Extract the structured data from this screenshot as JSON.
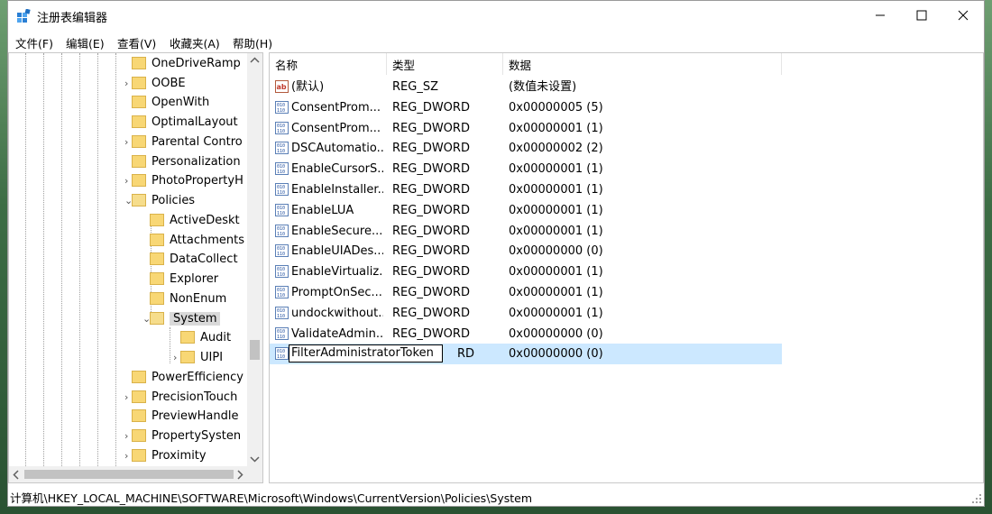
{
  "window": {
    "title": "注册表编辑器"
  },
  "menu": [
    "文件(F)",
    "编辑(E)",
    "查看(V)",
    "收藏夹(A)",
    "帮助(H)"
  ],
  "tree": [
    {
      "label": "OneDriveRamp",
      "expander": ""
    },
    {
      "label": "OOBE",
      "expander": "›"
    },
    {
      "label": "OpenWith",
      "expander": ""
    },
    {
      "label": "OptimalLayout",
      "expander": ""
    },
    {
      "label": "Parental Contro",
      "expander": "›"
    },
    {
      "label": "Personalization",
      "expander": ""
    },
    {
      "label": "PhotoPropertyH",
      "expander": "›"
    },
    {
      "label": "Policies",
      "expander": "⌄"
    },
    {
      "label": "ActiveDeskt",
      "expander": ""
    },
    {
      "label": "Attachments",
      "expander": ""
    },
    {
      "label": "DataCollect",
      "expander": ""
    },
    {
      "label": "Explorer",
      "expander": ""
    },
    {
      "label": "NonEnum",
      "expander": ""
    },
    {
      "label": "System",
      "expander": "⌄"
    },
    {
      "label": "Audit",
      "expander": ""
    },
    {
      "label": "UIPI",
      "expander": "›"
    },
    {
      "label": "PowerEfficiency",
      "expander": ""
    },
    {
      "label": "PrecisionTouch",
      "expander": "›"
    },
    {
      "label": "PreviewHandle",
      "expander": ""
    },
    {
      "label": "PropertySysten",
      "expander": "›"
    },
    {
      "label": "Proximity",
      "expander": "›"
    }
  ],
  "columns": {
    "name": "名称",
    "type": "类型",
    "data": "数据"
  },
  "values": [
    {
      "name": "(默认)",
      "type": "REG_SZ",
      "data": "(数值未设置)",
      "icon": "string-value-icon"
    },
    {
      "name": "ConsentProm...",
      "type": "REG_DWORD",
      "data": "0x00000005 (5)",
      "icon": "dword-value-icon"
    },
    {
      "name": "ConsentProm...",
      "type": "REG_DWORD",
      "data": "0x00000001 (1)",
      "icon": "dword-value-icon"
    },
    {
      "name": "DSCAutomatio...",
      "type": "REG_DWORD",
      "data": "0x00000002 (2)",
      "icon": "dword-value-icon"
    },
    {
      "name": "EnableCursorS...",
      "type": "REG_DWORD",
      "data": "0x00000001 (1)",
      "icon": "dword-value-icon"
    },
    {
      "name": "EnableInstaller...",
      "type": "REG_DWORD",
      "data": "0x00000001 (1)",
      "icon": "dword-value-icon"
    },
    {
      "name": "EnableLUA",
      "type": "REG_DWORD",
      "data": "0x00000001 (1)",
      "icon": "dword-value-icon"
    },
    {
      "name": "EnableSecure...",
      "type": "REG_DWORD",
      "data": "0x00000001 (1)",
      "icon": "dword-value-icon"
    },
    {
      "name": "EnableUIADes...",
      "type": "REG_DWORD",
      "data": "0x00000000 (0)",
      "icon": "dword-value-icon"
    },
    {
      "name": "EnableVirtualiz...",
      "type": "REG_DWORD",
      "data": "0x00000001 (1)",
      "icon": "dword-value-icon"
    },
    {
      "name": "PromptOnSec...",
      "type": "REG_DWORD",
      "data": "0x00000001 (1)",
      "icon": "dword-value-icon"
    },
    {
      "name": "undockwithout...",
      "type": "REG_DWORD",
      "data": "0x00000001 (1)",
      "icon": "dword-value-icon"
    },
    {
      "name": "ValidateAdmin...",
      "type": "REG_DWORD",
      "data": "0x00000000 (0)",
      "icon": "dword-value-icon"
    }
  ],
  "editing_row": {
    "name": "FilterAdministratorToken",
    "type_visible": "RD",
    "data": "0x00000000 (0)",
    "icon": "dword-value-icon"
  },
  "status": "计算机\\HKEY_LOCAL_MACHINE\\SOFTWARE\\Microsoft\\Windows\\CurrentVersion\\Policies\\System",
  "colors": {
    "selection": "#cce8ff",
    "folder": "#f8d775",
    "tree_selected": "#d9d9d9"
  }
}
